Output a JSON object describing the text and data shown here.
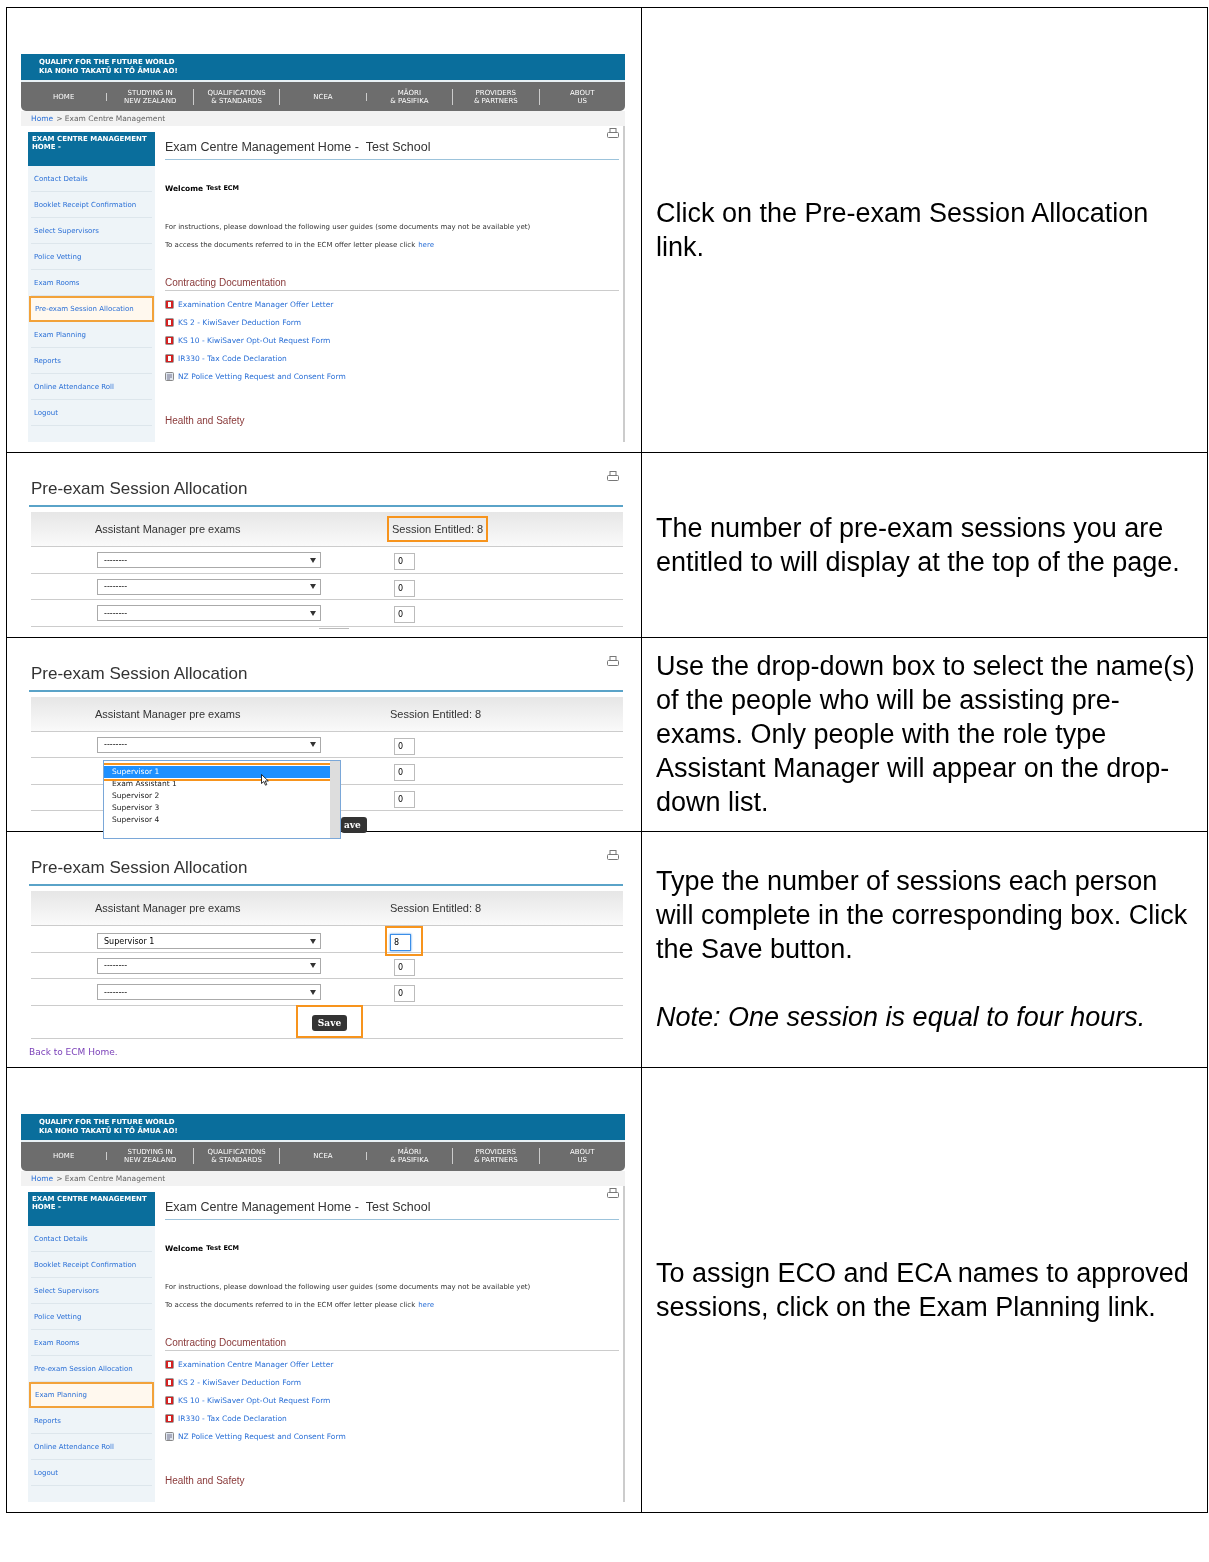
{
  "steps": [
    {
      "screen": {
        "kind": "home",
        "banner": [
          "QUALIFY FOR THE FUTURE WORLD",
          "KIA NOHO TAKATŪ KI TŌ ĀMUA AO!"
        ],
        "nav": [
          [
            "HOME"
          ],
          [
            "STUDYING IN",
            "NEW ZEALAND"
          ],
          [
            "QUALIFICATIONS",
            "& STANDARDS"
          ],
          [
            "NCEA"
          ],
          [
            "MĀORI",
            "& PASIFIKA"
          ],
          [
            "PROVIDERS",
            "& PARTNERS"
          ],
          [
            "ABOUT",
            "US"
          ]
        ],
        "breadcrumb_link": "Home",
        "breadcrumb_current": "> Exam Centre Management",
        "sidebar_heading": "EXAM CENTRE MANAGEMENT HOME -",
        "sidebar": [
          {
            "label": "Contact Details",
            "highlighted": false
          },
          {
            "label": "Booklet Receipt Confirmation",
            "highlighted": false
          },
          {
            "label": "Select Supervisors",
            "highlighted": false
          },
          {
            "label": "Police Vetting",
            "highlighted": false
          },
          {
            "label": "Exam Rooms",
            "highlighted": false
          },
          {
            "label": "Pre-exam Session Allocation",
            "highlighted": true
          },
          {
            "label": "Exam Planning",
            "highlighted": false
          },
          {
            "label": "Reports",
            "highlighted": false
          },
          {
            "label": "Online Attendance Roll",
            "highlighted": false
          },
          {
            "label": "Logout",
            "highlighted": false
          }
        ],
        "title": "Exam Centre Management Home -",
        "school": "Test School",
        "welcome": "Welcome",
        "user": "Test ECM",
        "instructions": "For instructions, please download the following user guides (some documents may not be available yet)",
        "access_text": "To access the documents referred to in the ECM offer letter please click",
        "access_link": "here",
        "section": "Contracting Documentation",
        "documents": [
          {
            "kind": "pdf",
            "label": "Examination Centre Manager Offer Letter"
          },
          {
            "kind": "pdf",
            "label": "KS 2 - KiwiSaver Deduction Form"
          },
          {
            "kind": "pdf",
            "label": "KS 10 - KiwiSaver Opt-Out Request Form"
          },
          {
            "kind": "pdf",
            "label": "IR330 - Tax Code Declaration"
          },
          {
            "kind": "form",
            "label": "NZ Police Vetting Request and Consent Form"
          }
        ],
        "next_section": "Health and Safety"
      },
      "instruction": [
        {
          "text": "Click on the Pre-exam Session Allocation link.",
          "italic": false
        }
      ]
    },
    {
      "screen": {
        "kind": "allocation",
        "title": "Pre-exam Session Allocation",
        "column_1": "Assistant Manager pre exams",
        "column_2": "Session Entitled: 8",
        "entitled_highlighted": true,
        "rows": [
          {
            "choice": "--------",
            "sessions": "0",
            "focused": false
          },
          {
            "choice": "--------",
            "sessions": "0",
            "focused": false
          },
          {
            "choice": "--------",
            "sessions": "0",
            "focused": false
          }
        ]
      },
      "instruction": [
        {
          "text": "The number of pre-exam sessions you are entitled to will display at the top of the page.",
          "italic": false
        }
      ]
    },
    {
      "screen": {
        "kind": "allocation",
        "title": "Pre-exam Session Allocation",
        "column_1": "Assistant Manager pre exams",
        "column_2": "Session Entitled: 8",
        "entitled_highlighted": false,
        "rows": [
          {
            "choice": "--------",
            "sessions": "0",
            "focused": false
          },
          {
            "choice": "",
            "sessions": "0",
            "focused": false
          },
          {
            "choice": "",
            "sessions": "0",
            "focused": false
          }
        ],
        "dropdown": [
          {
            "label": "Supervisor 1",
            "selected": true
          },
          {
            "label": "Exam Assistant 1",
            "selected": false
          },
          {
            "label": "Supervisor 2",
            "selected": false
          },
          {
            "label": "Supervisor 3",
            "selected": false
          },
          {
            "label": "Supervisor 4",
            "selected": false
          }
        ],
        "save": {
          "label": "ave"
        }
      },
      "instruction": [
        {
          "text": "Use the drop-down box to select the name(s) of the people who will be assisting pre-exams. Only people with the role type Assistant Manager will appear on the drop-down list.",
          "italic": false
        }
      ]
    },
    {
      "screen": {
        "kind": "allocation",
        "title": "Pre-exam Session Allocation",
        "column_1": "Assistant Manager pre exams",
        "column_2": "Session Entitled: 8",
        "entitled_highlighted": false,
        "rows": [
          {
            "choice": "Supervisor 1",
            "sessions": "8",
            "focused": true
          },
          {
            "choice": "--------",
            "sessions": "0",
            "focused": false
          },
          {
            "choice": "--------",
            "sessions": "0",
            "focused": false
          }
        ],
        "save": {
          "label": "Save",
          "highlighted": true
        },
        "back_link": "Back to ECM Home."
      },
      "instruction": [
        {
          "text": "Type the number of sessions each person will complete in the corresponding box. Click the Save button.",
          "italic": false
        },
        {
          "text": "Note: One session is equal to four hours.",
          "italic": true
        }
      ]
    },
    {
      "screen": {
        "kind": "home",
        "banner": [
          "QUALIFY FOR THE FUTURE WORLD",
          "KIA NOHO TAKATŪ KI TŌ ĀMUA AO!"
        ],
        "nav": [
          [
            "HOME"
          ],
          [
            "STUDYING IN",
            "NEW ZEALAND"
          ],
          [
            "QUALIFICATIONS",
            "& STANDARDS"
          ],
          [
            "NCEA"
          ],
          [
            "MĀORI",
            "& PASIFIKA"
          ],
          [
            "PROVIDERS",
            "& PARTNERS"
          ],
          [
            "ABOUT",
            "US"
          ]
        ],
        "breadcrumb_link": "Home",
        "breadcrumb_current": "> Exam Centre Management",
        "sidebar_heading": "EXAM CENTRE MANAGEMENT HOME -",
        "sidebar": [
          {
            "label": "Contact Details",
            "highlighted": false
          },
          {
            "label": "Booklet Receipt Confirmation",
            "highlighted": false
          },
          {
            "label": "Select Supervisors",
            "highlighted": false
          },
          {
            "label": "Police Vetting",
            "highlighted": false
          },
          {
            "label": "Exam Rooms",
            "highlighted": false
          },
          {
            "label": "Pre-exam Session Allocation",
            "highlighted": false
          },
          {
            "label": "Exam Planning",
            "highlighted": true
          },
          {
            "label": "Reports",
            "highlighted": false
          },
          {
            "label": "Online Attendance Roll",
            "highlighted": false
          },
          {
            "label": "Logout",
            "highlighted": false
          }
        ],
        "title": "Exam Centre Management Home -",
        "school": "Test School",
        "welcome": "Welcome",
        "user": "Test ECM",
        "instructions": "For instructions, please download the following user guides (some documents may not be available yet)",
        "access_text": "To access the documents referred to in the ECM offer letter please click",
        "access_link": "here",
        "section": "Contracting Documentation",
        "documents": [
          {
            "kind": "pdf",
            "label": "Examination Centre Manager Offer Letter"
          },
          {
            "kind": "pdf",
            "label": "KS 2 - KiwiSaver Deduction Form"
          },
          {
            "kind": "pdf",
            "label": "KS 10 - KiwiSaver Opt-Out Request Form"
          },
          {
            "kind": "pdf",
            "label": "IR330 - Tax Code Declaration"
          },
          {
            "kind": "form",
            "label": "NZ Police Vetting Request and Consent Form"
          }
        ],
        "next_section": "Health and Safety"
      },
      "instruction": [
        {
          "text": "To assign ECO and ECA names to approved sessions, click on the Exam Planning link.",
          "italic": false
        }
      ]
    }
  ]
}
